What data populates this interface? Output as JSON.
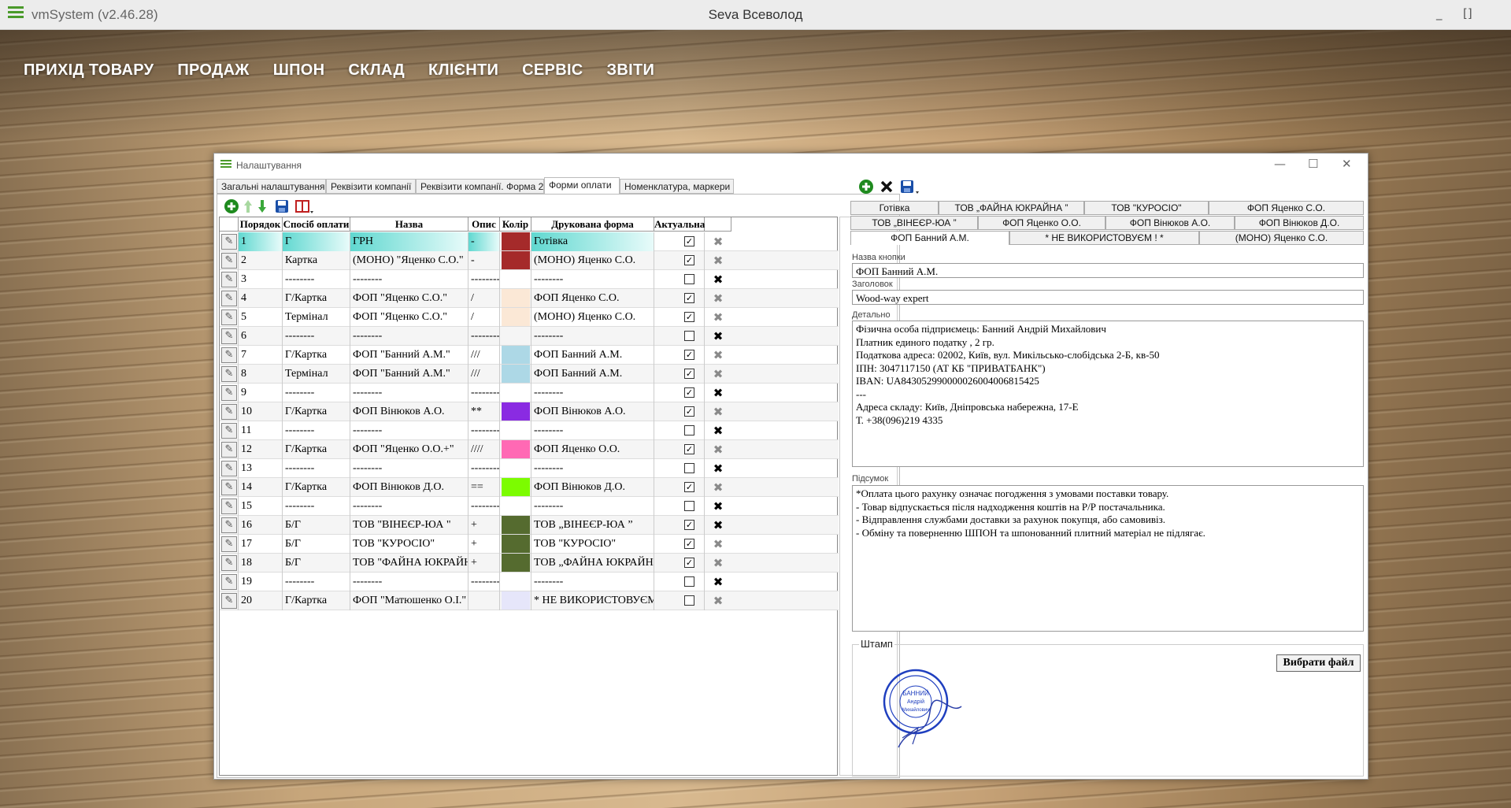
{
  "app": {
    "name": "vmSystem (v2.46.28)",
    "user": "Seva Всеволод",
    "min": "_",
    "max": "[]"
  },
  "menu": [
    "ПРИХІД ТОВАРУ",
    "ПРОДАЖ",
    "ШПОН",
    "СКЛАД",
    "КЛІЄНТИ",
    "СЕРВІС",
    "ЗВІТИ"
  ],
  "dialog": {
    "title": "Налаштування",
    "tabs": [
      "Загальні налаштування",
      "Реквізити компанії",
      "Реквізити компанії. Форма 2",
      "Форми оплати",
      "Номенклатура, маркери"
    ],
    "active_tab": "Форми оплати"
  },
  "grid": {
    "headers": [
      "Порядок",
      "Спосіб оплати",
      "Назва",
      "Опис",
      "Колір",
      "Друкована форма",
      "Актуальна"
    ],
    "rows": [
      {
        "n": "1",
        "sp": "Г",
        "nm": "ГРН",
        "op": "-",
        "color": "#a52a2a",
        "pf": "Готівка",
        "act": true,
        "del": "grey",
        "sel": true
      },
      {
        "n": "2",
        "sp": "Картка",
        "nm": "(МОНО) \"Яценко С.О.\"",
        "op": "-",
        "color": "#a52a2a",
        "pf": "(МОНО)  Яценко С.О.",
        "act": true,
        "del": "grey"
      },
      {
        "n": "3",
        "sp": "--------",
        "nm": "--------",
        "op": "--------",
        "color": "#ffffff",
        "pf": "--------",
        "act": false,
        "del": "black"
      },
      {
        "n": "4",
        "sp": "Г/Картка",
        "nm": "ФОП \"Яценко С.О.\"",
        "op": "/",
        "color": "#fbe8d6",
        "pf": "ФОП  Яценко С.О.",
        "act": true,
        "del": "grey"
      },
      {
        "n": "5",
        "sp": "Термінал",
        "nm": "ФОП \"Яценко С.О.\"",
        "op": "/",
        "color": "#fbe8d6",
        "pf": "(МОНО)  Яценко С.О.",
        "act": true,
        "del": "grey"
      },
      {
        "n": "6",
        "sp": "--------",
        "nm": "--------",
        "op": "--------",
        "color": "#f5f5f5",
        "pf": "--------",
        "act": false,
        "del": "black"
      },
      {
        "n": "7",
        "sp": "Г/Картка",
        "nm": "ФОП \"Банний А.М.\"",
        "op": "///",
        "color": "#add8e6",
        "pf": "ФОП  Банний А.М.",
        "act": true,
        "del": "grey"
      },
      {
        "n": "8",
        "sp": "Термінал",
        "nm": "ФОП \"Банний А.М.\"",
        "op": "///",
        "color": "#add8e6",
        "pf": "ФОП  Банний А.М.",
        "act": true,
        "del": "grey"
      },
      {
        "n": "9",
        "sp": "--------",
        "nm": "--------",
        "op": "--------",
        "color": "#ffffff",
        "pf": "--------",
        "act": true,
        "del": "black"
      },
      {
        "n": "10",
        "sp": "Г/Картка",
        "nm": "ФОП  Вінюков А.О.",
        "op": "**",
        "color": "#8a2be2",
        "pf": "ФОП  Вінюков А.О.",
        "act": true,
        "del": "grey"
      },
      {
        "n": "11",
        "sp": "--------",
        "nm": "--------",
        "op": "--------",
        "color": "#ffffff",
        "pf": "--------",
        "act": false,
        "del": "black"
      },
      {
        "n": "12",
        "sp": "Г/Картка",
        "nm": "ФОП \"Яценко О.О.+\"",
        "op": "////",
        "color": "#ff69b4",
        "pf": "ФОП  Яценко О.О.",
        "act": true,
        "del": "grey"
      },
      {
        "n": "13",
        "sp": "--------",
        "nm": "--------",
        "op": "--------",
        "color": "#ffffff",
        "pf": "--------",
        "act": false,
        "del": "black"
      },
      {
        "n": "14",
        "sp": "Г/Картка",
        "nm": "ФОП  Вінюков Д.О.",
        "op": "==",
        "color": "#7cfc00",
        "pf": "ФОП  Вінюков Д.О.",
        "act": true,
        "del": "grey"
      },
      {
        "n": "15",
        "sp": "--------",
        "nm": "--------",
        "op": "--------",
        "color": "#ffffff",
        "pf": "--------",
        "act": false,
        "del": "black"
      },
      {
        "n": "16",
        "sp": "Б/Г",
        "nm": "ТОВ \"ВІНЕЄР-ЮА \"",
        "op": "+",
        "color": "#556b2f",
        "pf": "ТОВ „ВІНЕЄР-ЮА ”",
        "act": true,
        "del": "black"
      },
      {
        "n": "17",
        "sp": "Б/Г",
        "nm": "ТОВ \"КУРОСІО\"",
        "op": "+",
        "color": "#556b2f",
        "pf": "ТОВ \"КУРОСІО\"",
        "act": true,
        "del": "grey"
      },
      {
        "n": "18",
        "sp": "Б/Г",
        "nm": "ТОВ \"ФАЙНА ЮКРАЙНА\"",
        "op": "+",
        "color": "#556b2f",
        "pf": "ТОВ „ФАЙНА ЮКРАЙНА ”",
        "act": true,
        "del": "grey"
      },
      {
        "n": "19",
        "sp": "--------",
        "nm": "--------",
        "op": "--------",
        "color": "#ffffff",
        "pf": "--------",
        "act": false,
        "del": "black"
      },
      {
        "n": "20",
        "sp": "Г/Картка",
        "nm": "ФОП \"Матюшенко О.І.\"",
        "op": "",
        "color": "#e6e6fa",
        "pf": "* НЕ ВИКОРИСТОВУЄМ ! *",
        "act": false,
        "del": "grey"
      }
    ]
  },
  "right": {
    "btn_tabs_row1": [
      "Готівка",
      "ТОВ „ФАЙНА ЮКРАЙНА ”",
      "ТОВ \"КУРОСІО\"",
      "ФОП  Яценко С.О."
    ],
    "btn_tabs_row2": [
      "ТОВ „ВІНЕЄР-ЮА ”",
      "ФОП  Яценко О.О.",
      "ФОП  Вінюков А.О.",
      "ФОП  Вінюков Д.О."
    ],
    "btn_tabs_row3": [
      "ФОП  Банний А.М.",
      "* НЕ ВИКОРИСТОВУЄМ ! *",
      "(МОНО)  Яценко С.О."
    ],
    "label_button_name": "Назва кнопки",
    "button_name": "ФОП  Банний А.М.",
    "label_heading": "Заголовок",
    "heading": "Wood-way expert",
    "label_details": "Детально",
    "details": [
      "Фізична особа підприємець: Банний Андрій Михайлович",
      "Платник единого податку , 2 гр.",
      "Податкова адреса: 02002, Київ, вул. Микільсько-слобідська 2-Б, кв-50",
      "ІПН:  3047117150   (АТ КБ \"ПРИВАТБАНК\")",
      "IBAN:  UA843052990000026004006815425",
      "---",
      "Адреса складу: Київ, Дніпровська набережна, 17-Е",
      "Т. +38(096)219 4335"
    ],
    "label_summary": "Підсумок",
    "summary": [
      "*Оплата цього рахунку означає погодження з умовами поставки товару.",
      "- Товар відпускається після надходження коштів на  Р/Р постачальника.",
      "- Відправлення службами доставки за рахунок покупця, або самовивіз.",
      "- Обміну та поверненню ШПОН та шпонованний плитний матеріал не підлягає."
    ],
    "label_stamp": "Штамп",
    "pick_file": "Вибрати файл",
    "stamp_text": [
      "БАННИЙ",
      "Андрій",
      "Михайлович"
    ]
  }
}
